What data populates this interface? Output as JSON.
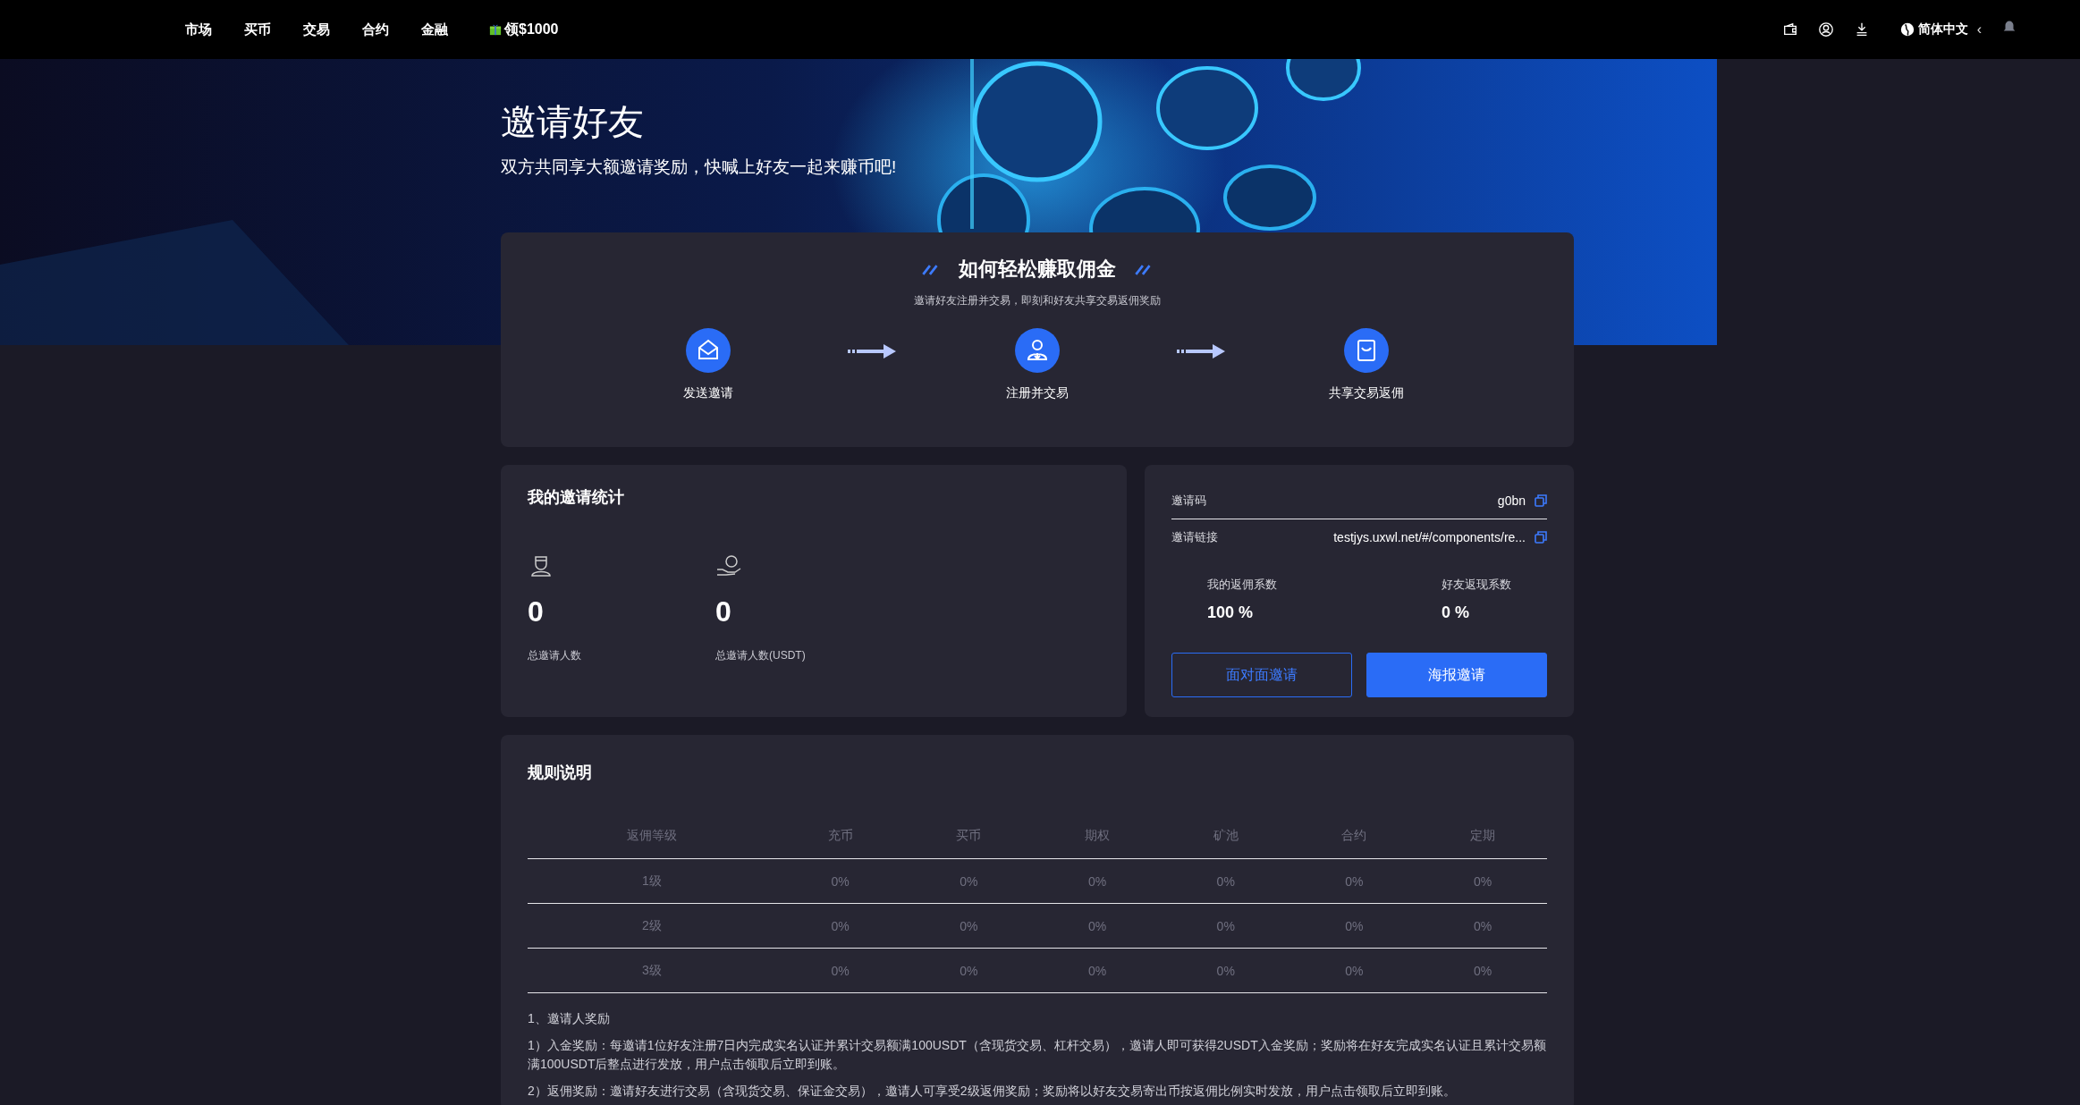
{
  "nav": {
    "items": [
      {
        "label": "市场"
      },
      {
        "label": "买币"
      },
      {
        "label": "交易"
      },
      {
        "label": "合约"
      },
      {
        "label": "金融"
      }
    ],
    "promo": {
      "label": "领$1000"
    },
    "language": {
      "label": "简体中文",
      "caret": "‹"
    }
  },
  "hero": {
    "title": "邀请好友",
    "subtitle": "双方共同享大额邀请奖励，快喊上好友一起来赚币吧!"
  },
  "howto": {
    "title": "如何轻松赚取佣金",
    "subtitle": "邀请好友注册并交易，即刻和好友共享交易返佣奖励",
    "steps": [
      {
        "label": "发送邀请",
        "kind": "envelope"
      },
      {
        "label": "注册并交易",
        "kind": "user"
      },
      {
        "label": "共享交易返佣",
        "kind": "share"
      }
    ]
  },
  "stats": {
    "title": "我的邀请统计",
    "items": [
      {
        "value": "0",
        "label": "总邀请人数",
        "kind": "person"
      },
      {
        "value": "0",
        "label": "总邀请人数(USDT)",
        "kind": "coin"
      }
    ]
  },
  "invite": {
    "rows": [
      {
        "label": "邀请码",
        "value": "g0bn"
      },
      {
        "label": "邀请链接",
        "value": "testjys.uxwl.net/#/components/re..."
      }
    ],
    "rates": [
      {
        "label": "我的返佣系数",
        "value": "100 %"
      },
      {
        "label": "好友返现系数",
        "value": "0 %"
      }
    ],
    "buttons": [
      {
        "label": "面对面邀请",
        "kind": "outline"
      },
      {
        "label": "海报邀请",
        "kind": "primary"
      }
    ]
  },
  "rules": {
    "title": "规则说明",
    "columns": [
      "返佣等级",
      "充币",
      "买币",
      "期权",
      "矿池",
      "合约",
      "定期"
    ],
    "rows": [
      [
        "1级",
        "0%",
        "0%",
        "0%",
        "0%",
        "0%",
        "0%"
      ],
      [
        "2级",
        "0%",
        "0%",
        "0%",
        "0%",
        "0%",
        "0%"
      ],
      [
        "3级",
        "0%",
        "0%",
        "0%",
        "0%",
        "0%",
        "0%"
      ]
    ],
    "paragraphs": [
      "1、邀请人奖励",
      "1）入金奖励：每邀请1位好友注册7日内完成实名认证并累计交易额满100USDT（含现货交易、杠杆交易），邀请人即可获得2USDT入金奖励；奖励将在好友完成实名认证且累计交易额满100USDT后整点进行发放，用户点击领取后立即到账。",
      "2）返佣奖励：邀请好友进行交易（含现货交易、保证金交易），邀请人可享受2级返佣奖励；奖励将以好友交易寄出币按返佣比例实时发放，用户点击领取后立即到账。"
    ]
  }
}
